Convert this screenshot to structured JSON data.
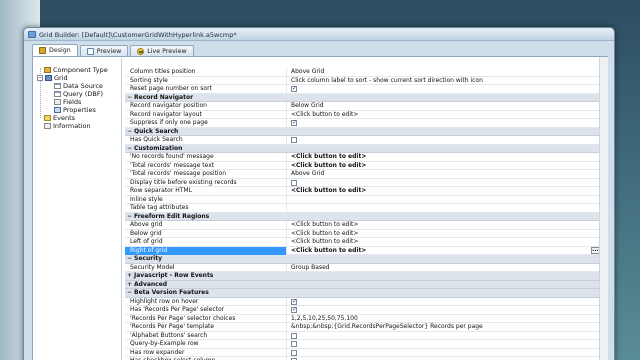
{
  "window": {
    "title": "Grid Builder: [Default]\\CustomerGridWithHyperlink.a5wcmp*"
  },
  "tabs": [
    {
      "label": "Design",
      "icon": "design-icon"
    },
    {
      "label": "Preview",
      "icon": "preview-icon"
    },
    {
      "label": "Live Preview",
      "icon": "live-preview-icon"
    }
  ],
  "tree": {
    "component_type": "Component Type",
    "grid": "Grid",
    "data_source": "Data Source",
    "query": "Query (DBF)",
    "fields": "Fields",
    "properties": "Properties",
    "events": "Events",
    "information": "Information"
  },
  "grid": {
    "rows": [
      {
        "t": "p",
        "name": "Column titles position",
        "value": "Above Grid"
      },
      {
        "t": "p",
        "name": "Sorting style",
        "value": "Click column label to sort - show current sort direction with icon"
      },
      {
        "t": "c",
        "name": "Reset page number on sort",
        "checked": true
      },
      {
        "t": "s",
        "name": "Record Navigator",
        "exp": "−"
      },
      {
        "t": "p",
        "name": "Record navigator position",
        "value": "Below Grid"
      },
      {
        "t": "p",
        "name": "Record navigator layout",
        "value": "<Click button to edit>"
      },
      {
        "t": "c",
        "name": "Suppress if only one page",
        "checked": true
      },
      {
        "t": "s",
        "name": "Quick Search",
        "exp": "−"
      },
      {
        "t": "c",
        "name": "Has Quick Search",
        "checked": false
      },
      {
        "t": "s",
        "name": "Customization",
        "exp": "−"
      },
      {
        "t": "p",
        "name": "'No records found' message",
        "value": "<Click button to edit>",
        "bold": true
      },
      {
        "t": "p",
        "name": "'Total records' message text",
        "value": "<Click button to edit>",
        "bold": true
      },
      {
        "t": "p",
        "name": "'Total records' message position",
        "value": "Above Grid"
      },
      {
        "t": "c",
        "name": "Display title before existing records",
        "checked": false
      },
      {
        "t": "p",
        "name": "Row separator HTML",
        "value": "<Click button to edit>",
        "bold": true
      },
      {
        "t": "p",
        "name": "Inline style",
        "value": ""
      },
      {
        "t": "p",
        "name": "Table tag attributes",
        "value": ""
      },
      {
        "t": "s",
        "name": "Freeform Edit Regions",
        "exp": "−"
      },
      {
        "t": "p",
        "name": "Above grid",
        "value": "<Click button to edit>"
      },
      {
        "t": "p",
        "name": "Below grid",
        "value": "<Click button to edit>"
      },
      {
        "t": "p",
        "name": "Left of grid",
        "value": "<Click button to edit>"
      },
      {
        "t": "p",
        "name": "Right of grid",
        "value": "<Click button to edit>",
        "bold": true,
        "selected": true,
        "ellipsis": "..."
      },
      {
        "t": "s",
        "name": "Security",
        "exp": "−"
      },
      {
        "t": "p",
        "name": "Security Model",
        "value": "Group Based"
      },
      {
        "t": "s",
        "name": "Javascript - Row Events",
        "exp": "+"
      },
      {
        "t": "s",
        "name": "Advanced",
        "exp": "+"
      },
      {
        "t": "s",
        "name": "Beta Version Features",
        "exp": "−"
      },
      {
        "t": "c",
        "name": "Highlight row on hover",
        "checked": true
      },
      {
        "t": "c",
        "name": "Has 'Records Per Page' selector",
        "checked": true
      },
      {
        "t": "p",
        "name": "'Records Per Page' selector choices",
        "value": "1,2,5,10,25,50,75,100"
      },
      {
        "t": "p",
        "name": "'Records Per Page' template",
        "value": "&nbsp;&nbsp;{Grid.RecordsPerPageSelector} Records per page"
      },
      {
        "t": "c",
        "name": "'Alphabet Buttons' search",
        "checked": false
      },
      {
        "t": "c",
        "name": "Query-by-Example row",
        "checked": false
      },
      {
        "t": "c",
        "name": "Has row expander",
        "checked": false
      },
      {
        "t": "c",
        "name": "Has checkbox select column",
        "checked": false
      }
    ]
  }
}
